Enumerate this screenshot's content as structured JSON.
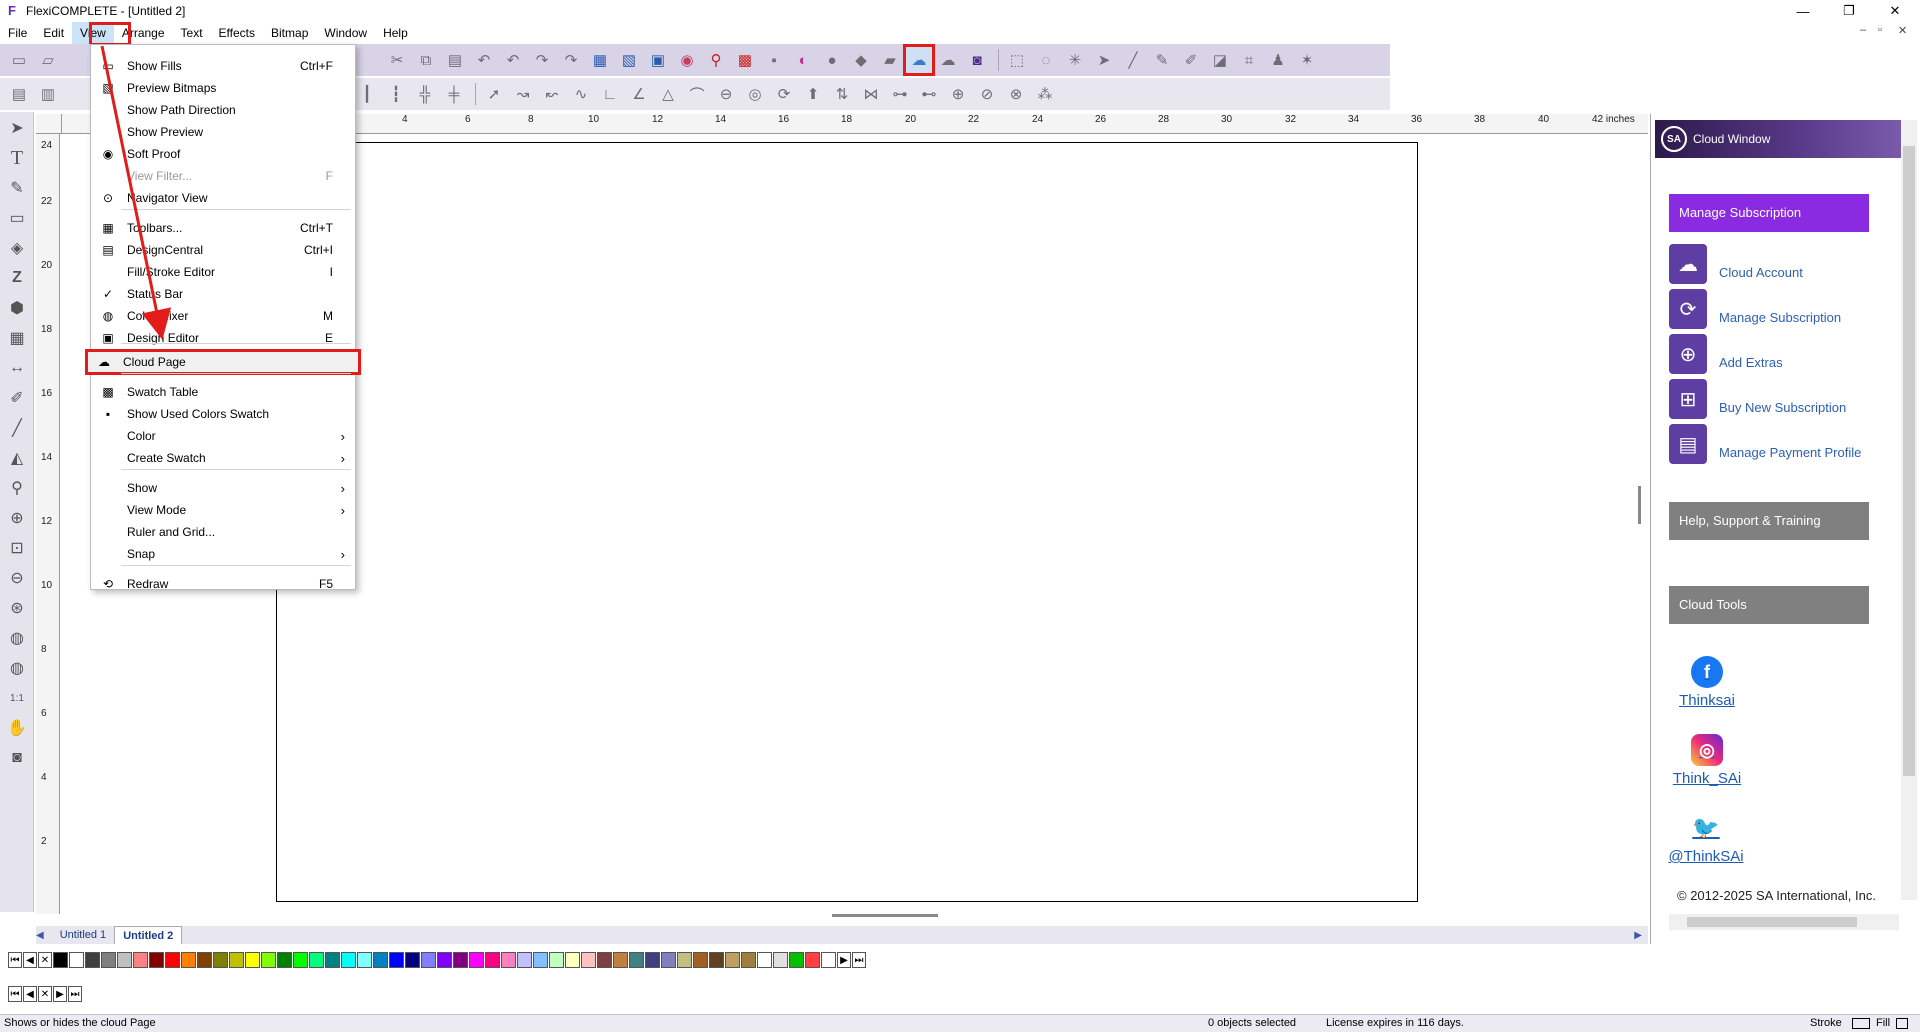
{
  "window": {
    "title": "FlexiCOMPLETE - [Untitled 2]",
    "app_icon": "F",
    "minimize": "—",
    "restore": "❐",
    "close": "✕"
  },
  "menubar": {
    "items": [
      "File",
      "Edit",
      "View",
      "Arrange",
      "Text",
      "Effects",
      "Bitmap",
      "Window",
      "Help"
    ]
  },
  "mdi_controls": {
    "minimize": "–",
    "restore": "▫",
    "close": "✕"
  },
  "view_menu": {
    "items": [
      {
        "label": "Show Fills",
        "shortcut": "Ctrl+F",
        "icon": "fill-icon"
      },
      {
        "label": "Preview Bitmaps",
        "shortcut": "",
        "icon": "bitmap-icon"
      },
      {
        "label": "Show Path Direction",
        "shortcut": "",
        "icon": ""
      },
      {
        "label": "Show Preview",
        "shortcut": "",
        "icon": ""
      },
      {
        "label": "Soft Proof",
        "shortcut": "",
        "icon": "color-wheel-icon"
      },
      {
        "label": "View Filter...",
        "shortcut": "F",
        "icon": "",
        "disabled": true
      },
      {
        "label": "Navigator View",
        "shortcut": "",
        "icon": "navigator-icon"
      },
      {
        "label": "Toolbars...",
        "shortcut": "Ctrl+T",
        "icon": "toolbars-icon"
      },
      {
        "label": "DesignCentral",
        "shortcut": "Ctrl+I",
        "icon": "design-central-icon"
      },
      {
        "label": "Fill/Stroke Editor",
        "shortcut": "I",
        "icon": ""
      },
      {
        "label": "Status Bar",
        "shortcut": "",
        "icon": "check-icon"
      },
      {
        "label": "Color Mixer",
        "shortcut": "M",
        "icon": "color-mixer-icon"
      },
      {
        "label": "Design Editor",
        "shortcut": "E",
        "icon": "design-editor-icon"
      },
      {
        "label": "Cloud Page",
        "shortcut": "",
        "icon": "cloud-icon"
      },
      {
        "label": "Swatch Table",
        "shortcut": "",
        "icon": "swatch-table-icon"
      },
      {
        "label": "Show Used Colors Swatch",
        "shortcut": "",
        "icon": "used-colors-icon"
      },
      {
        "label": "Color",
        "shortcut": "",
        "submenu": true
      },
      {
        "label": "Create Swatch",
        "shortcut": "",
        "submenu": true
      },
      {
        "label": "Show",
        "shortcut": "",
        "submenu": true
      },
      {
        "label": "View Mode",
        "shortcut": "",
        "submenu": true
      },
      {
        "label": "Ruler and Grid...",
        "shortcut": ""
      },
      {
        "label": "Snap",
        "shortcut": "",
        "submenu": true
      },
      {
        "label": "Redraw",
        "shortcut": "F5",
        "icon": "redraw-icon"
      }
    ]
  },
  "ruler": {
    "unit": "inches",
    "top_ticks": [
      "4",
      "6",
      "8",
      "10",
      "12",
      "14",
      "16",
      "18",
      "20",
      "22",
      "24",
      "26",
      "28",
      "30",
      "32",
      "34",
      "36",
      "38",
      "40",
      "42 inches"
    ],
    "left_ticks": [
      "24",
      "22",
      "20",
      "18",
      "16",
      "14",
      "12",
      "10",
      "8",
      "6",
      "4",
      "2"
    ]
  },
  "doc_tabs": [
    "Untitled 1",
    "Untitled 2"
  ],
  "cloud_window": {
    "title": "Cloud Window",
    "logo": "SA",
    "manage_subscription_btn": "Manage Subscription",
    "links": [
      "Cloud Account",
      "Manage Subscription",
      "Add Extras",
      "Buy New Subscription",
      "Manage Payment Profile"
    ],
    "help_btn": "Help, Support & Training",
    "tools_btn": "Cloud Tools",
    "social": [
      {
        "name": "Thinksai",
        "icon": "facebook-icon"
      },
      {
        "name": "Think_SAi",
        "icon": "instagram-icon"
      },
      {
        "name": "@ThinkSAi",
        "icon": "twitter-icon"
      }
    ],
    "footer": "© 2012-2025 SA International, Inc.",
    "colors": {
      "purple": "#8a2be2",
      "gray": "#808080"
    }
  },
  "palette_colors": [
    "#000000",
    "#ffffff",
    "#404040",
    "#808080",
    "#c0c0c0",
    "#ff8080",
    "#800000",
    "#ff0000",
    "#ff8000",
    "#804000",
    "#808000",
    "#c0c000",
    "#ffff00",
    "#80ff00",
    "#008000",
    "#00ff00",
    "#00ff80",
    "#008080",
    "#00ffff",
    "#80ffff",
    "#0080c0",
    "#0000ff",
    "#000080",
    "#8080ff",
    "#8000ff",
    "#800080",
    "#ff00ff",
    "#ff0080",
    "#ff80c0",
    "#c0c0ff",
    "#80c0ff",
    "#c0ffc0",
    "#ffffc0",
    "#ffc0c0",
    "#804040",
    "#c08040",
    "#408080",
    "#404080",
    "#8080c0",
    "#c0c080",
    "#a06020",
    "#604020",
    "#c0a060",
    "#a08040",
    "#ffffff",
    "#e0e0e0",
    "#00c000",
    "#ff4040",
    "#ffffff"
  ],
  "statusbar": {
    "hint": "Shows or hides the cloud Page",
    "selection": "0 objects selected",
    "license": "License expires in 116 days.",
    "stroke": "Stroke",
    "fill": "Fill"
  }
}
